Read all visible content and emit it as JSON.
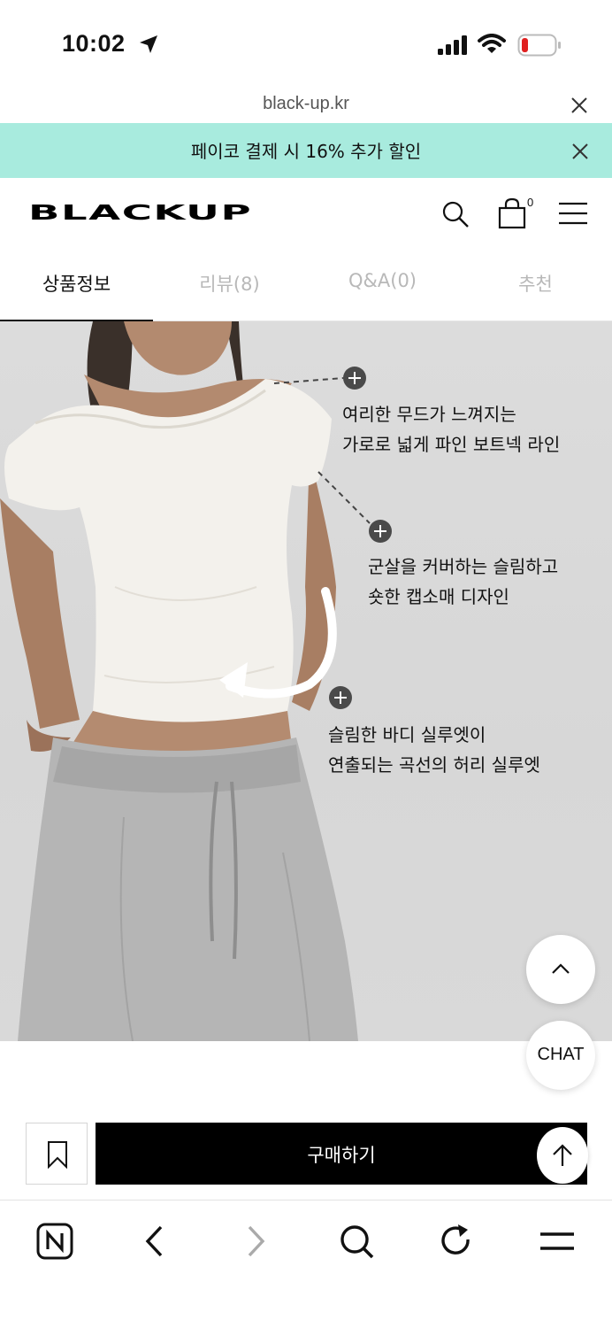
{
  "status_bar": {
    "time": "10:02"
  },
  "browser": {
    "url": "black-up.kr"
  },
  "promo": {
    "text": "페이코 결제 시 16% 추가 할인"
  },
  "header": {
    "logo": "BLACKUP",
    "cart_count": "0"
  },
  "tabs": [
    {
      "label": "상품정보",
      "active": true
    },
    {
      "label": "리뷰(8)",
      "active": false
    },
    {
      "label": "Q&A(0)",
      "active": false
    },
    {
      "label": "추천",
      "active": false
    }
  ],
  "callouts": [
    {
      "line1": "여리한 무드가 느껴지는",
      "line2": "가로로 넓게 파인 보트넥 라인"
    },
    {
      "line1": "군살을 커버하는 슬림하고",
      "line2": "숏한 캡소매 디자인"
    },
    {
      "line1": "슬림한 바디 실루엣이",
      "line2": "연출되는 곡선의 허리 실루엣"
    }
  ],
  "floating": {
    "chat_label": "CHAT"
  },
  "purchase": {
    "buy_label": "구매하기"
  },
  "colors": {
    "promo_bg": "#a8ebde",
    "buy_bg": "#000000",
    "battery_low": "#e02020"
  },
  "icons": [
    "location-arrow-icon",
    "signal-icon",
    "wifi-icon",
    "battery-icon",
    "close-icon",
    "search-icon",
    "cart-icon",
    "menu-icon",
    "chevron-up-icon",
    "bookmark-icon",
    "arrow-up-icon",
    "naver-n-icon",
    "back-icon",
    "forward-icon",
    "refresh-icon"
  ]
}
